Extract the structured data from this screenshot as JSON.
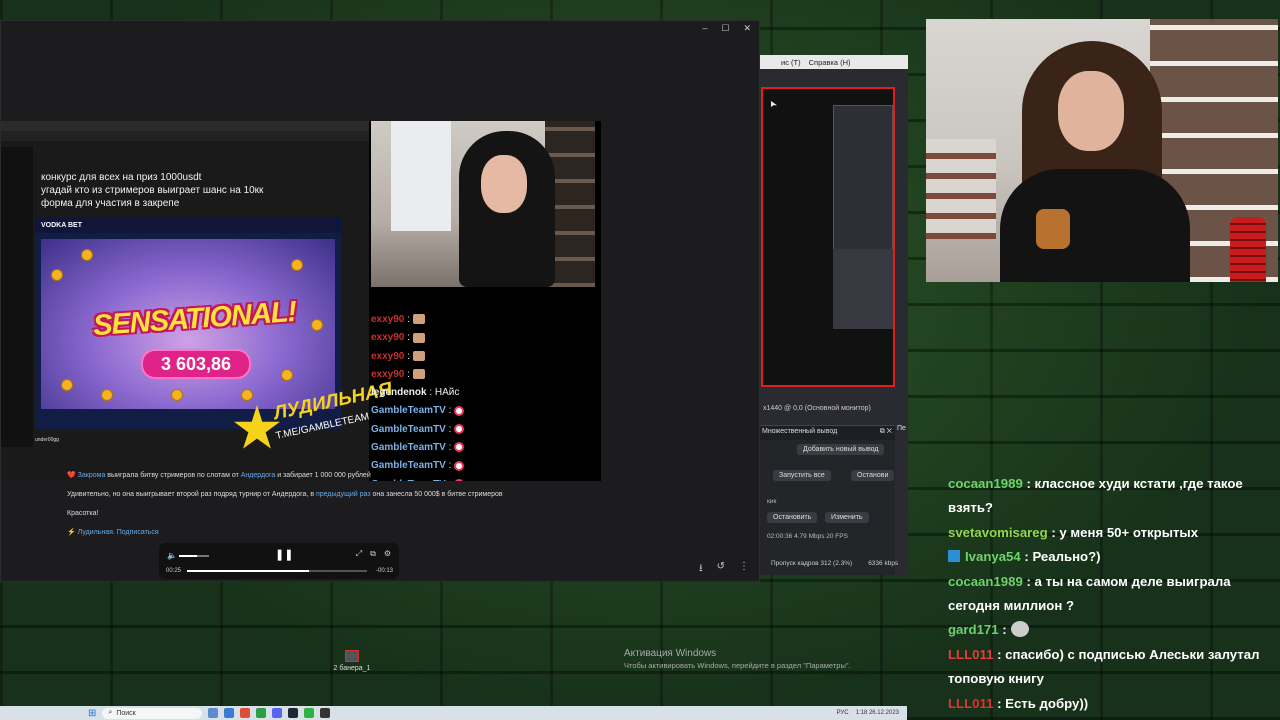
{
  "telegram": {
    "window_controls": [
      "–",
      "☐",
      "✕"
    ],
    "contest_lines": [
      "конкурс для всех на приз 1000usdt",
      "угадай кто из стримеров выиграет шанс на 10кк",
      "форма для участия в закрепе"
    ],
    "casino": {
      "brand": "VODKA BET",
      "win_title": "SENSATIONAL!",
      "win_amount": "3 603,86",
      "streamer": "under00gg"
    },
    "promo": {
      "name": "ЛУДИЛЬНАЯ",
      "url": "T.ME/GAMBLETEAM"
    },
    "mini_chat": [
      {
        "user": "exxy90",
        "sep": " :",
        "emote": "pic",
        "cls": "u"
      },
      {
        "user": "exxy90",
        "sep": " :",
        "emote": "pic",
        "cls": "u"
      },
      {
        "user": "exxy90",
        "sep": " :",
        "emote": "pic",
        "cls": "u"
      },
      {
        "user": "exxy90",
        "sep": " :",
        "emote": "pic",
        "cls": "u"
      },
      {
        "user": "legendenok",
        "sep": " : НАйс",
        "emote": "",
        "cls": "u w"
      },
      {
        "user": "GambleTeamTV",
        "sep": " :",
        "emote": "heart",
        "cls": "u b"
      },
      {
        "user": "GambleTeamTV",
        "sep": " :",
        "emote": "heart",
        "cls": "u b"
      },
      {
        "user": "GambleTeamTV",
        "sep": " :",
        "emote": "heart",
        "cls": "u b"
      },
      {
        "user": "GambleTeamTV",
        "sep": " :",
        "emote": "heart",
        "cls": "u b"
      },
      {
        "user": "GambleTeamTV",
        "sep": " :",
        "emote": "heart",
        "cls": "u b"
      }
    ],
    "post": {
      "line1_a": "Закрома",
      "line1_b": " выиграла битву стримеров по слотам от ",
      "line1_c": "Андердога",
      "line1_d": " и забирает 1 000 000 рублей",
      "line2_a": "Удивительно, но она выигрывает второй раз подряд турнир от Андердога, в ",
      "line2_b": "предыдущий раз",
      "line2_c": " она занесла 50 000$ в битве стримеров",
      "line3": "Красотка!",
      "line4": "Лудильная. Подписаться"
    },
    "player": {
      "time_current": "00:25",
      "time_left": "-00:13",
      "progress": 0.68,
      "volume": 0.6
    }
  },
  "obs": {
    "menu": [
      "ис (Т)",
      "Справка (Н)"
    ],
    "monitor_label": "x1440 @ 0,0 (Основной монитор)",
    "dock_title": "Множественный вывод",
    "add_output": "Добавить новый вывод",
    "start_all": "Запустить все",
    "stop_short": "Останови",
    "output_name": "кик",
    "stop": "Остановить",
    "edit": "Изменить",
    "stats": "02:00:36  4.79 Mbps  20 FPS",
    "dropped": "Пропуск кадров 312 (2.3%)",
    "bitrate": "6336 kbps",
    "side_label": "Пе"
  },
  "desktop": {
    "icon_label": "2 банера_1",
    "activation_title": "Активация Windows",
    "activation_sub": "Чтобы активировать Windows, перейдите в раздел \"Параметры\"."
  },
  "taskbar": {
    "search_placeholder": "Поиск",
    "lang": "РУС",
    "time": "1:18",
    "date": "26.12.2023"
  },
  "chat": [
    {
      "user": "cocaan1989",
      "text": " : классное худи кстати ,где такое взять?",
      "cls": "u1"
    },
    {
      "user": "svetavomisareg",
      "text": " : у меня 50+ открытых",
      "cls": "u2"
    },
    {
      "user": "Ivanya54",
      "text": " : Реально?)",
      "cls": "u1",
      "badge": true
    },
    {
      "user": "cocaan1989",
      "text": " : а ты на самом деле выиграла сегодня миллион ?",
      "cls": "u1"
    },
    {
      "user": "gard171",
      "text": " :",
      "cls": "u4",
      "emote": true
    },
    {
      "user": "LLL011",
      "text": " : спасибо) с подписью Алеськи залутал топовую книгу",
      "cls": "u3"
    },
    {
      "user": "LLL011",
      "text": " : Есть добру))",
      "cls": "u5"
    }
  ],
  "colors": {
    "accent_red": "#e01e1e",
    "chat_green": "#6ed36a",
    "chat_red": "#e93b3b",
    "brick": "#1a3517"
  }
}
